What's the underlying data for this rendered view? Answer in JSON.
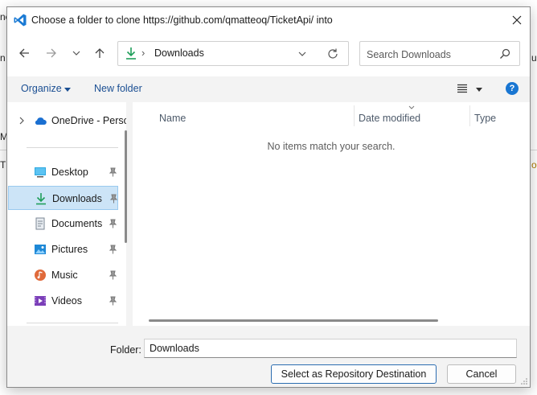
{
  "background": {
    "fragments": [
      "ne",
      "n V",
      "Mo",
      "TS",
      "u",
      "o"
    ]
  },
  "dialog": {
    "title": "Choose a folder to clone https://github.com/qmatteoq/TicketApi/ into",
    "app_icon": "vscode-icon",
    "close_icon": "close-icon"
  },
  "navigation": {
    "back_icon": "back-arrow-icon",
    "forward_icon": "forward-arrow-icon",
    "recent_icon": "chevron-down-icon",
    "up_icon": "up-arrow-icon",
    "address": {
      "icon": "download-icon",
      "separator": "›",
      "location": "Downloads"
    },
    "search": {
      "placeholder": "Search Downloads",
      "value": ""
    }
  },
  "toolbar": {
    "organize_label": "Organize",
    "new_folder_label": "New folder",
    "help_label": "?"
  },
  "nav_pane": {
    "items": [
      {
        "label": "OneDrive - Perso",
        "icon": "cloud-icon",
        "expandable": true
      },
      {
        "label": "Desktop",
        "icon": "desktop-icon",
        "pinned": true
      },
      {
        "label": "Downloads",
        "icon": "download-icon",
        "pinned": true,
        "selected": true
      },
      {
        "label": "Documents",
        "icon": "document-icon",
        "pinned": true
      },
      {
        "label": "Pictures",
        "icon": "pictures-icon",
        "pinned": true
      },
      {
        "label": "Music",
        "icon": "music-icon",
        "pinned": true
      },
      {
        "label": "Videos",
        "icon": "videos-icon",
        "pinned": true
      }
    ]
  },
  "file_list": {
    "columns": [
      "Name",
      "Date modified",
      "Type"
    ],
    "empty_message": "No items match your search."
  },
  "footer": {
    "folder_label": "Folder:",
    "folder_value": "Downloads",
    "select_button": "Select as Repository Destination",
    "cancel_button": "Cancel"
  },
  "colors": {
    "accent_link": "#1b4f93",
    "selection": "#cce4f7",
    "help_badge": "#1976d2"
  }
}
